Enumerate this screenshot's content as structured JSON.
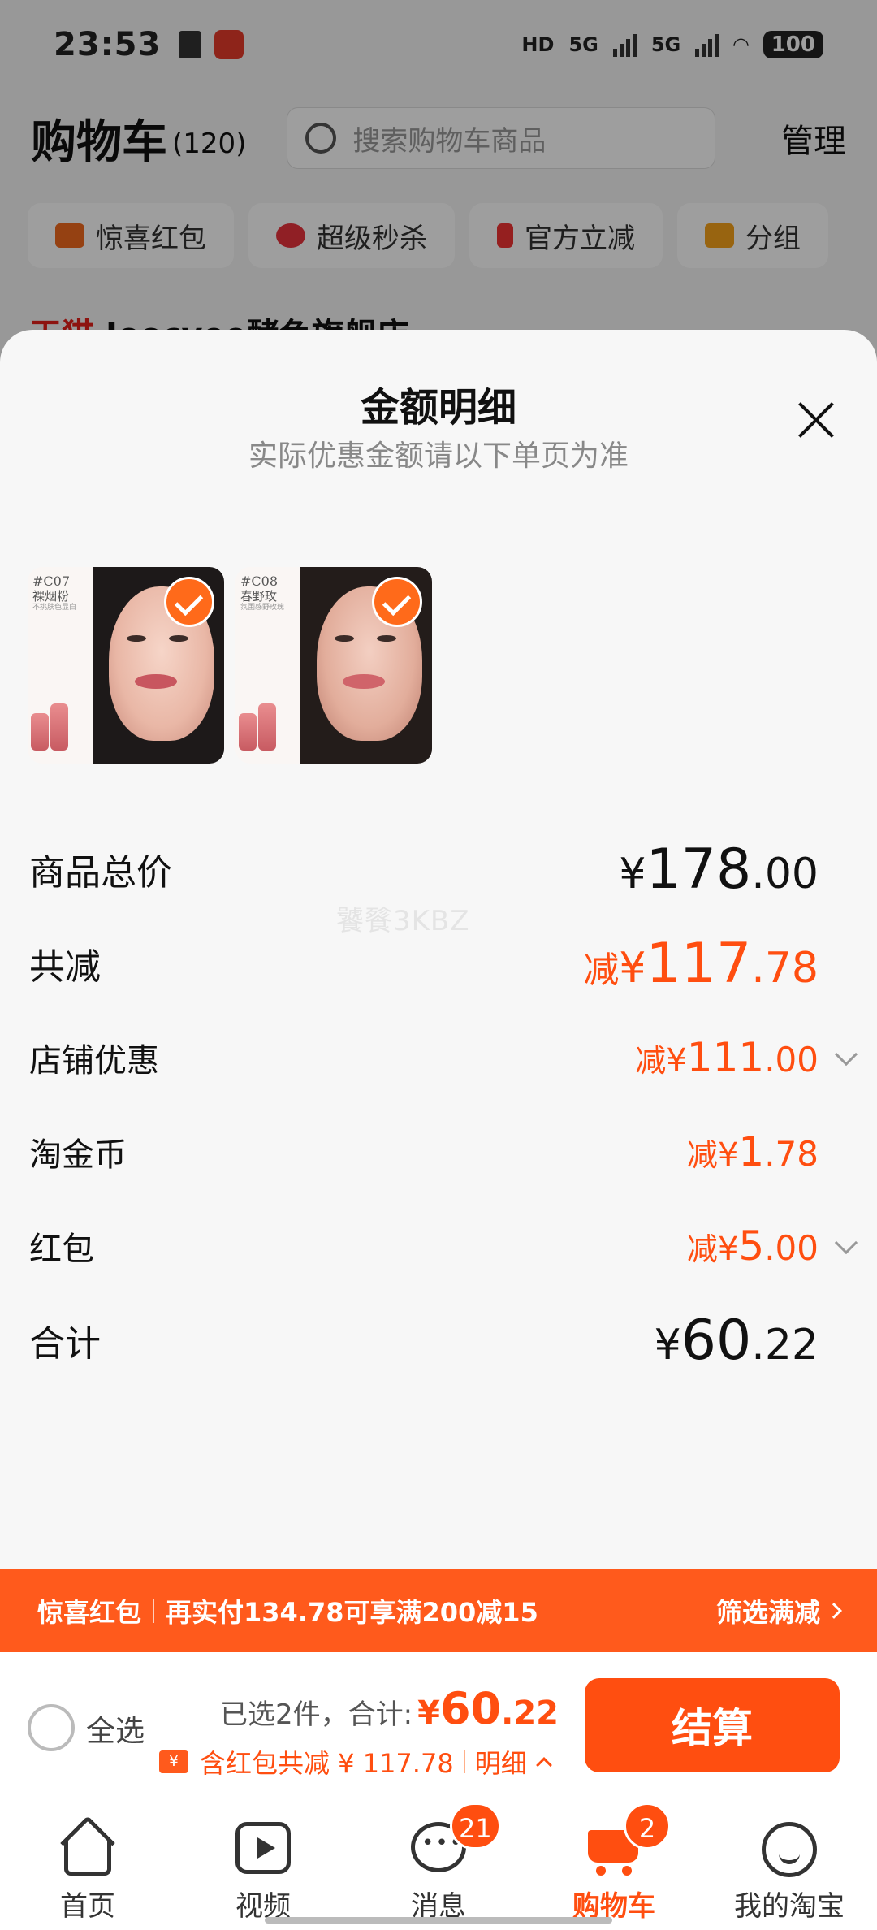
{
  "status_bar": {
    "time": "23:53",
    "battery": "100",
    "net1": "5G",
    "net2": "5G",
    "hd": "HD"
  },
  "cart_header": {
    "title": "购物车",
    "count": "(120)",
    "search_placeholder": "搜索购物车商品",
    "manage": "管理"
  },
  "chips": [
    {
      "label": "惊喜红包",
      "color": "#f06a1e"
    },
    {
      "label": "超级秒杀",
      "color": "#e8323c"
    },
    {
      "label": "官方立减",
      "color": "#f03232"
    },
    {
      "label": "分组",
      "color": "#f5a21b"
    }
  ],
  "bg_store": {
    "brand": "天猫",
    "name": "Joocyee酵色旗舰店"
  },
  "sheet": {
    "title": "金额明细",
    "subtitle": "实际优惠金额请以下单页为准",
    "products": [
      {
        "code": "#C07",
        "name": "裸烟粉",
        "desc": "不挑肤色显白"
      },
      {
        "code": "#C08",
        "name": "春野玫",
        "desc": "氛围感野玫瑰"
      }
    ],
    "watermark": "饕餮3KBZ"
  },
  "breakdown": {
    "total_price": {
      "label": "商品总价",
      "rmb": "¥",
      "int": "178",
      "dec": ".00"
    },
    "total_discount": {
      "label": "共减",
      "prefix": "减",
      "rmb": "¥",
      "int": "117",
      "dec": ".78"
    },
    "store_discount": {
      "label": "店铺优惠",
      "prefix": "减",
      "rmb": "¥",
      "int": "111",
      "dec": ".00"
    },
    "taojinbi": {
      "label": "淘金币",
      "prefix": "减",
      "rmb": "¥",
      "int": "1",
      "dec": ".78"
    },
    "hongbao": {
      "label": "红包",
      "prefix": "减",
      "rmb": "¥",
      "int": "5",
      "dec": ".00"
    },
    "sum": {
      "label": "合计",
      "rmb": "¥",
      "int": "60",
      "dec": ".22"
    }
  },
  "promo": {
    "tag": "惊喜红包",
    "text": "再实付134.78可享满200减15",
    "filter": "筛选满减"
  },
  "checkout": {
    "select_all": "全选",
    "selected": "已选2件，",
    "total_label": "合计:",
    "rmb": "¥",
    "int": "60",
    "dec": ".22",
    "coupon_icon": "¥",
    "discount_text": "含红包共减 ¥ 117.78",
    "detail": "明细",
    "pay": "结算"
  },
  "tabbar": [
    {
      "label": "首页",
      "icon": "home-icon"
    },
    {
      "label": "视频",
      "icon": "video-icon"
    },
    {
      "label": "消息",
      "icon": "message-icon",
      "badge": "21"
    },
    {
      "label": "购物车",
      "icon": "cart-icon",
      "badge": "2",
      "active": true
    },
    {
      "label": "我的淘宝",
      "icon": "profile-icon"
    }
  ],
  "colors": {
    "accent": "#ff4e10",
    "promo_bar": "#ff5a1c"
  }
}
